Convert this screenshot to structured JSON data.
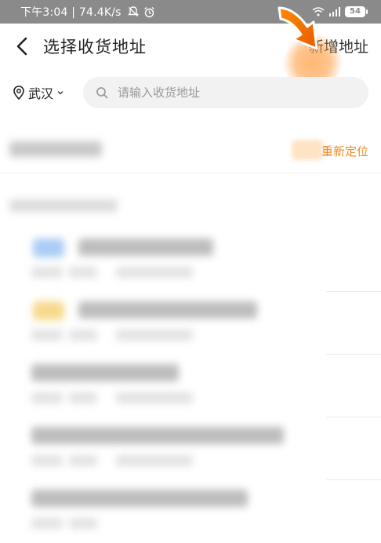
{
  "status_bar": {
    "text": "下午3:04 | 74.4K/s",
    "battery": "54",
    "colors": {
      "background": "#8a8a8a",
      "foreground": "#ffffff"
    }
  },
  "header": {
    "title": "选择收货地址",
    "add_address_label": "新增地址",
    "back_icon": "chevron-left-icon"
  },
  "search": {
    "city": "武汉",
    "placeholder": "请输入收货地址",
    "value": ""
  },
  "location": {
    "relocate_label": "重新定位",
    "accent_color": "#f08a24"
  },
  "icons": {
    "location_pin": "location-pin-icon",
    "search": "search-icon",
    "dropdown": "chevron-down-icon",
    "arrow_pointer": "arrow-pointer-icon"
  }
}
